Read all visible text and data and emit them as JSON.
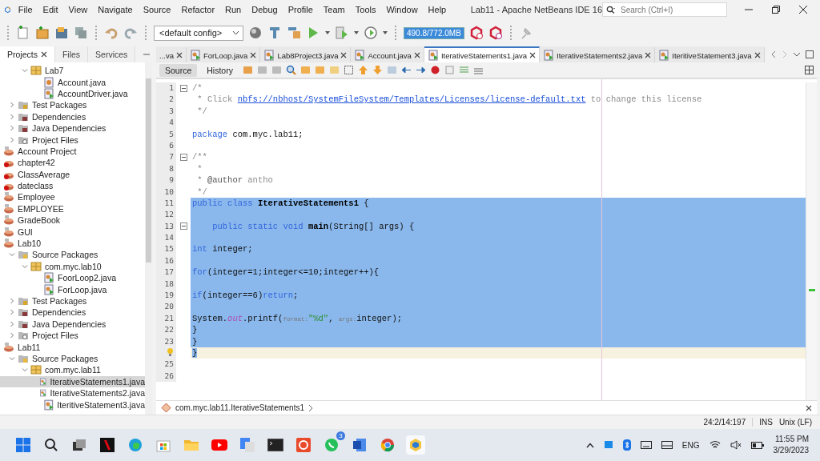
{
  "window": {
    "title": "Lab11 - Apache NetBeans IDE 16",
    "search": {
      "placeholder": "Search (Ctrl+I)"
    }
  },
  "menu": [
    "File",
    "Edit",
    "View",
    "Navigate",
    "Source",
    "Refactor",
    "Run",
    "Debug",
    "Profile",
    "Team",
    "Tools",
    "Window",
    "Help"
  ],
  "toolbar": {
    "config": "<default config>",
    "memory": "490.8/772.0MB"
  },
  "sidebar": {
    "tabs": [
      {
        "label": "Projects",
        "selected": true
      },
      {
        "label": "Files",
        "selected": false
      },
      {
        "label": "Services",
        "selected": false
      }
    ],
    "tree": {
      "partial_packages": [
        {
          "label": "Lab7",
          "kind": "package",
          "expanded": true,
          "selected": false,
          "children": [
            {
              "label": "Account.java",
              "kind": "java",
              "selected": false
            },
            {
              "label": "AccountDriver.java",
              "kind": "java_main",
              "selected": false
            }
          ]
        }
      ],
      "partial_project_items": [
        {
          "label": "Test Packages",
          "kind": "folder_test",
          "expanded": false,
          "selected": false
        },
        {
          "label": "Dependencies",
          "kind": "folder_deps",
          "expanded": false,
          "selected": false
        },
        {
          "label": "Java Dependencies",
          "kind": "folder_deps",
          "expanded": false,
          "selected": false
        },
        {
          "label": "Project Files",
          "kind": "folder_files",
          "expanded": false,
          "selected": false
        }
      ],
      "projects": [
        {
          "label": "Account Project",
          "kind": "project",
          "selected": false
        },
        {
          "label": "chapter42",
          "kind": "project_error",
          "selected": false
        },
        {
          "label": "ClassAverage",
          "kind": "project_error",
          "selected": false
        },
        {
          "label": "dateclass",
          "kind": "project_error",
          "selected": false
        },
        {
          "label": "Employee",
          "kind": "project",
          "selected": false
        },
        {
          "label": "EMPLOYEE",
          "kind": "project",
          "selected": false
        },
        {
          "label": "GradeBook",
          "kind": "project",
          "selected": false
        },
        {
          "label": "GUI",
          "kind": "project",
          "selected": false
        },
        {
          "label": "Lab10",
          "kind": "project",
          "selected": false,
          "children": [
            {
              "label": "Source Packages",
              "kind": "folder_src",
              "expanded": true,
              "selected": false,
              "children": [
                {
                  "label": "com.myc.lab10",
                  "kind": "package",
                  "expanded": true,
                  "selected": false,
                  "children": [
                    {
                      "label": "FoorLoop2.java",
                      "kind": "java_main",
                      "selected": false
                    },
                    {
                      "label": "ForLoop.java",
                      "kind": "java_main",
                      "selected": false
                    }
                  ]
                }
              ]
            },
            {
              "label": "Test Packages",
              "kind": "folder_test",
              "expanded": false,
              "selected": false
            },
            {
              "label": "Dependencies",
              "kind": "folder_deps",
              "expanded": false,
              "selected": false
            },
            {
              "label": "Java Dependencies",
              "kind": "folder_deps",
              "expanded": false,
              "selected": false
            },
            {
              "label": "Project Files",
              "kind": "folder_files",
              "expanded": false,
              "selected": false
            }
          ]
        },
        {
          "label": "Lab11",
          "kind": "project",
          "selected": false,
          "children": [
            {
              "label": "Source Packages",
              "kind": "folder_src",
              "expanded": true,
              "selected": false,
              "children": [
                {
                  "label": "com.myc.lab11",
                  "kind": "package",
                  "expanded": true,
                  "selected": false,
                  "children": [
                    {
                      "label": "IterativeStatements1.java",
                      "kind": "java_main",
                      "selected": true
                    },
                    {
                      "label": "IterativeStatements2.java",
                      "kind": "java_main",
                      "selected": false
                    },
                    {
                      "label": "IteritiveStatement3.java",
                      "kind": "java_main",
                      "selected": false
                    }
                  ]
                }
              ]
            }
          ]
        }
      ]
    }
  },
  "editor_tabs": [
    {
      "label": "...va",
      "kind": "plain",
      "selected": false
    },
    {
      "label": "ForLoop.java",
      "kind": "java_main",
      "selected": false
    },
    {
      "label": "Lab8Project3.java",
      "kind": "java_main",
      "selected": false
    },
    {
      "label": "Account.java",
      "kind": "java_main",
      "selected": false
    },
    {
      "label": "IterativeStatements1.java",
      "kind": "java_main",
      "selected": true
    },
    {
      "label": "IterativeStatements2.java",
      "kind": "java_main",
      "selected": false
    },
    {
      "label": "IteritiveStatement3.java",
      "kind": "java_main",
      "selected": false
    }
  ],
  "editor_views": [
    {
      "label": "Source",
      "selected": true
    },
    {
      "label": "History",
      "selected": false
    }
  ],
  "code": {
    "lines": [
      {
        "number": "1",
        "fold": true,
        "selected": false,
        "current": false,
        "tokens": [
          {
            "kind": "comment",
            "text": "/*"
          }
        ]
      },
      {
        "number": "2",
        "selected": false,
        "current": false,
        "tokens": [
          {
            "kind": "comment",
            "text": " * Click "
          },
          {
            "kind": "link",
            "text": "nbfs://nbhost/SystemFileSystem/Templates/Licenses/license-default.txt"
          },
          {
            "kind": "comment",
            "text": " to change this license"
          }
        ]
      },
      {
        "number": "3",
        "selected": false,
        "current": false,
        "tokens": [
          {
            "kind": "comment",
            "text": " */"
          }
        ]
      },
      {
        "number": "4",
        "selected": false,
        "current": false
      },
      {
        "number": "5",
        "selected": false,
        "current": false,
        "tokens": [
          {
            "kind": "keyword",
            "text": "package"
          },
          {
            "kind": "plain",
            "text": " com.myc.lab11;"
          }
        ]
      },
      {
        "number": "6",
        "selected": false,
        "current": false
      },
      {
        "number": "7",
        "fold": true,
        "selected": false,
        "current": false,
        "tokens": [
          {
            "kind": "comment",
            "text": "/**"
          }
        ]
      },
      {
        "number": "8",
        "selected": false,
        "current": false,
        "tokens": [
          {
            "kind": "comment",
            "text": " *"
          }
        ]
      },
      {
        "number": "9",
        "selected": false,
        "current": false,
        "tokens": [
          {
            "kind": "comment",
            "text": " * "
          },
          {
            "kind": "tag",
            "text": "@author"
          },
          {
            "kind": "comment",
            "text": " antho"
          }
        ]
      },
      {
        "number": "10",
        "selected": false,
        "current": false,
        "tokens": [
          {
            "kind": "comment",
            "text": " */"
          }
        ]
      },
      {
        "number": "11",
        "selected": true,
        "current": false,
        "tokens": [
          {
            "kind": "keyword",
            "text": "public class "
          },
          {
            "kind": "bold",
            "text": "IterativeStatements1"
          },
          {
            "kind": "plain",
            "text": " {"
          }
        ]
      },
      {
        "number": "12",
        "selected": true,
        "current": false
      },
      {
        "number": "13",
        "fold": true,
        "selected": true,
        "current": false,
        "tokens": [
          {
            "kind": "keyword",
            "text": "    public static void "
          },
          {
            "kind": "bold",
            "text": "main"
          },
          {
            "kind": "plain",
            "text": "(String[] args) {"
          }
        ]
      },
      {
        "number": "14",
        "selected": true,
        "current": false
      },
      {
        "number": "15",
        "selected": true,
        "current": false,
        "tokens": [
          {
            "kind": "keyword",
            "text": "int"
          },
          {
            "kind": "plain",
            "text": " integer;"
          }
        ]
      },
      {
        "number": "16",
        "selected": true,
        "current": false
      },
      {
        "number": "17",
        "selected": true,
        "current": false,
        "tokens": [
          {
            "kind": "keyword",
            "text": "for"
          },
          {
            "kind": "plain",
            "text": "(integer=1;integer<=10;integer++){"
          }
        ]
      },
      {
        "number": "18",
        "selected": true,
        "current": false
      },
      {
        "number": "19",
        "selected": true,
        "current": false,
        "tokens": [
          {
            "kind": "keyword",
            "text": "if"
          },
          {
            "kind": "plain",
            "text": "(integer==6)"
          },
          {
            "kind": "keyword",
            "text": "return"
          },
          {
            "kind": "plain",
            "text": ";"
          }
        ]
      },
      {
        "number": "20",
        "selected": true,
        "current": false
      },
      {
        "number": "21",
        "selected": true,
        "current": false,
        "tokens": [
          {
            "kind": "plain",
            "text": "System."
          },
          {
            "kind": "field",
            "text": "out"
          },
          {
            "kind": "plain",
            "text": ".printf("
          },
          {
            "kind": "hint",
            "text": "format:"
          },
          {
            "kind": "string",
            "text": "\"%d\""
          },
          {
            "kind": "plain",
            "text": ", "
          },
          {
            "kind": "hint",
            "text": "args:"
          },
          {
            "kind": "plain",
            "text": "integer);"
          }
        ]
      },
      {
        "number": "22",
        "selected": true,
        "current": false,
        "tokens": [
          {
            "kind": "plain",
            "text": "}"
          }
        ]
      },
      {
        "number": "23",
        "selected": true,
        "current": false,
        "tokens": [
          {
            "kind": "plain",
            "text": "}"
          }
        ]
      },
      {
        "bulb": true,
        "selected": true,
        "current": true,
        "tokens": [
          {
            "kind": "plain",
            "text": "}"
          }
        ]
      },
      {
        "number": "25",
        "selected": false,
        "current": false
      },
      {
        "number": "26",
        "selected": false,
        "current": false
      }
    ]
  },
  "breadcrumb": "com.myc.lab11.IterativeStatements1",
  "status_bar": {
    "position": "24:2/14:197",
    "mode": "INS",
    "line_endings": "Unix (LF)"
  },
  "taskbar": {
    "whatsapp_badge": "3",
    "language": "ENG",
    "time": "11:55 PM",
    "date": "3/29/2023"
  }
}
